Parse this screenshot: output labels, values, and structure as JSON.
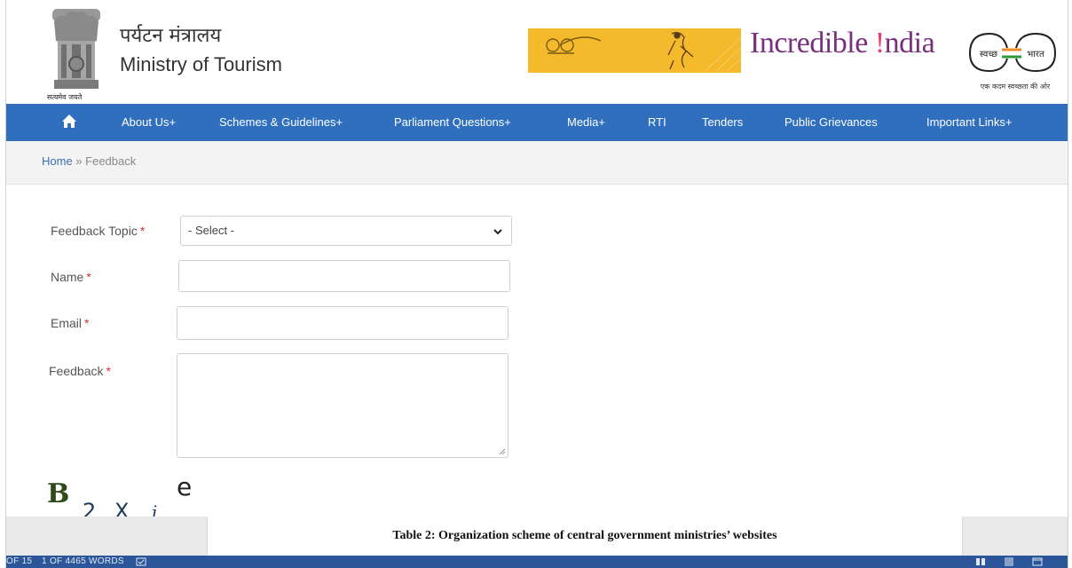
{
  "header": {
    "emblem_caption": "सत्यमेव जयते",
    "ministry_hindi": "पर्यटन मंत्रालय",
    "ministry_english": "Ministry of Tourism",
    "incredible_part1": "Incredible ",
    "incredible_part2": "ndia",
    "swachh_left": "स्वच्छ",
    "swachh_right": "भारत",
    "swachh_caption": "एक कदम स्वच्छता की ओर"
  },
  "nav": {
    "items": [
      {
        "label": "About Us+"
      },
      {
        "label": "Schemes & Guidelines+"
      },
      {
        "label": "Parliament Questions+"
      },
      {
        "label": "Media+"
      },
      {
        "label": "RTI"
      },
      {
        "label": "Tenders"
      },
      {
        "label": "Public Grievances"
      },
      {
        "label": "Important Links+"
      }
    ]
  },
  "breadcrumb": {
    "home": "Home",
    "separator": " » ",
    "current": "Feedback"
  },
  "form": {
    "topic_label": "Feedback Topic",
    "topic_selected": "- Select -",
    "name_label": "Name",
    "email_label": "Email",
    "feedback_label": "Feedback",
    "required_mark": "*"
  },
  "captcha": {
    "chars": [
      "B",
      "2",
      "X",
      "i",
      "e"
    ]
  },
  "document": {
    "caption": "Table 2: Organization scheme of central government ministries’ websites",
    "status_page": "OF 15",
    "status_words": "1 OF 4465 WORDS"
  },
  "colors": {
    "nav": "#2f6fbe",
    "required": "#d33",
    "status_bar": "#2b579a"
  }
}
